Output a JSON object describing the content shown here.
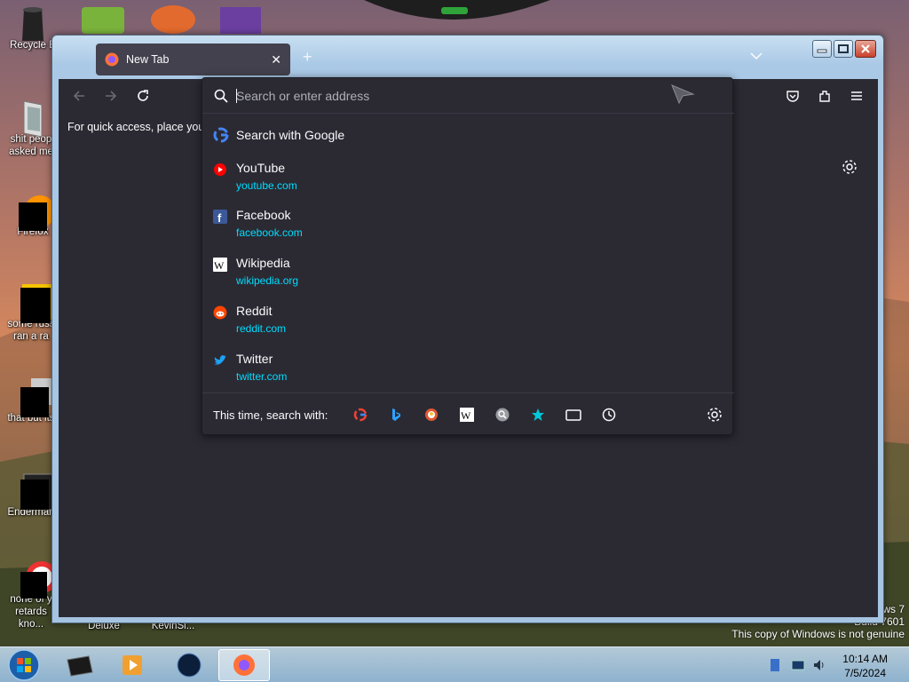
{
  "desktop": {
    "icons": [
      {
        "label": "Recycle B",
        "label2": ""
      },
      {
        "label": "shit peop",
        "label2": "asked me"
      },
      {
        "label": "Firefox",
        "label2": ""
      },
      {
        "label": "some russ",
        "label2": "ran a ra"
      },
      {
        "label": "that but its",
        "label2": ""
      },
      {
        "label": "Enderman",
        "label2": ""
      },
      {
        "label": "none of y",
        "label2": "retards kno..."
      }
    ],
    "bottom_labels": [
      "Deluxe",
      "KevinSi..."
    ],
    "watermark": {
      "line1": "ws 7",
      "line2": "Build 7601",
      "line3": "This copy of Windows is not genuine"
    }
  },
  "browser": {
    "tab": {
      "title": "New Tab",
      "new_tab": "+"
    },
    "bookmarks_hint": "For quick access, place your b",
    "urlbar": {
      "placeholder": "Search or enter address"
    },
    "suggestion_first": "Search with Google",
    "suggestions": [
      {
        "title": "YouTube",
        "url": "youtube.com",
        "icon": "youtube-icon",
        "color": "#ff0000"
      },
      {
        "title": "Facebook",
        "url": "facebook.com",
        "icon": "facebook-icon",
        "color": "#3b5998"
      },
      {
        "title": "Wikipedia",
        "url": "wikipedia.org",
        "icon": "wikipedia-icon",
        "color": "#ffffff"
      },
      {
        "title": "Reddit",
        "url": "reddit.com",
        "icon": "reddit-icon",
        "color": "#ff4500"
      },
      {
        "title": "Twitter",
        "url": "twitter.com",
        "icon": "twitter-icon",
        "color": "#1da1f2"
      }
    ],
    "search_with_label": "This time, search with:",
    "engines": [
      "google-icon",
      "bing-icon",
      "duckduckgo-icon",
      "wikipedia-icon",
      "search-engine-icon",
      "bookmarks-icon",
      "tabs-icon",
      "history-icon"
    ]
  },
  "taskbar": {
    "time": "10:14 AM",
    "date": "7/5/2024"
  },
  "colors": {
    "accent_link": "#00ddff",
    "panel": "#2b2a33",
    "text": "#fbfbfe"
  }
}
